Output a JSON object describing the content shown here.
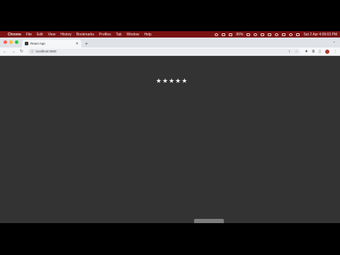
{
  "menubar": {
    "app_name": "Chrome",
    "items": [
      "File",
      "Edit",
      "View",
      "History",
      "Bookmarks",
      "Profiles",
      "Tab",
      "Window",
      "Help"
    ],
    "battery": "86%",
    "clock": "Sat 2 Apr  4:09:03 PM"
  },
  "browser": {
    "tab_title": "React App",
    "url": "localhost:3000"
  },
  "page": {
    "rating": {
      "value": 5,
      "max": 5,
      "star_glyph": "★"
    }
  },
  "colors": {
    "menubar_bg": "#7a1111",
    "page_bg": "#333333",
    "star": "#f2f2f2"
  }
}
